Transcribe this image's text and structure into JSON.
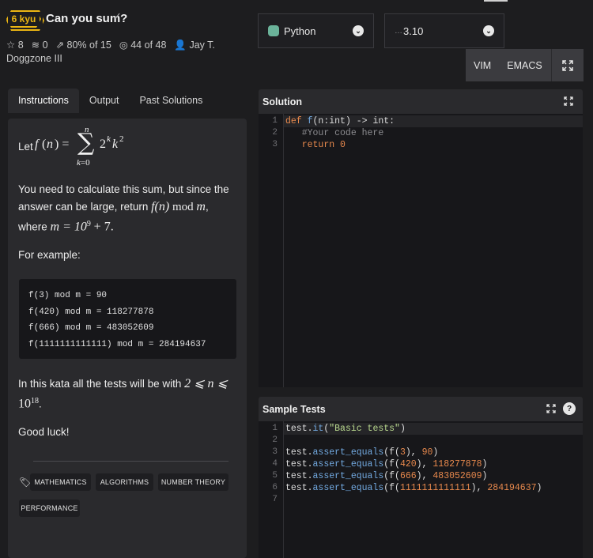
{
  "header": {
    "rank": "6 kyu",
    "title": "Can you sum?",
    "stats": {
      "stars": "8",
      "collections": "0",
      "satisfaction": "80% of 15",
      "completions": "44 of 48",
      "author": "Jay T.",
      "author_cont": "Doggzone III"
    }
  },
  "language": {
    "selected": "Python"
  },
  "version": {
    "selected": "3.10"
  },
  "editor_modes": {
    "vim": "VIM",
    "emacs": "EMACS"
  },
  "tabs": [
    "Instructions",
    "Output",
    "Past Solutions"
  ],
  "instructions": {
    "let": "Let",
    "p1a": "You need to calculate this sum, but since the",
    "p1b": "answer can be large, return",
    "p1b_math": "f(n)",
    "p1b_mod": "mod",
    "p1b_m": "m",
    "p1c": "where",
    "p1c_math": "m = 10",
    "p1c_exp": "9",
    "p1c_tail": "+ 7.",
    "example_label": "For example:",
    "examples": [
      "f(3) mod m = 90",
      "f(420) mod m = 118277878",
      "f(666) mod m = 483052609",
      "f(1111111111111) mod m = 284194637"
    ],
    "tests_a": "In this kata all the tests will be with",
    "tests_math": "2 ⩽ n ⩽",
    "tests_b": "10",
    "tests_exp": "18",
    "tests_end": ".",
    "good_luck": "Good luck!"
  },
  "tags": [
    "MATHEMATICS",
    "ALGORITHMS",
    "NUMBER THEORY",
    "PERFORMANCE"
  ],
  "solution": {
    "title": "Solution",
    "lines": [
      "1",
      "2",
      "3"
    ]
  },
  "sample_tests": {
    "title": "Sample Tests",
    "lines": [
      "1",
      "2",
      "3",
      "4",
      "5",
      "6",
      "7"
    ]
  },
  "colors": {
    "rank": "#ecb613",
    "accent": "#e8894d"
  }
}
